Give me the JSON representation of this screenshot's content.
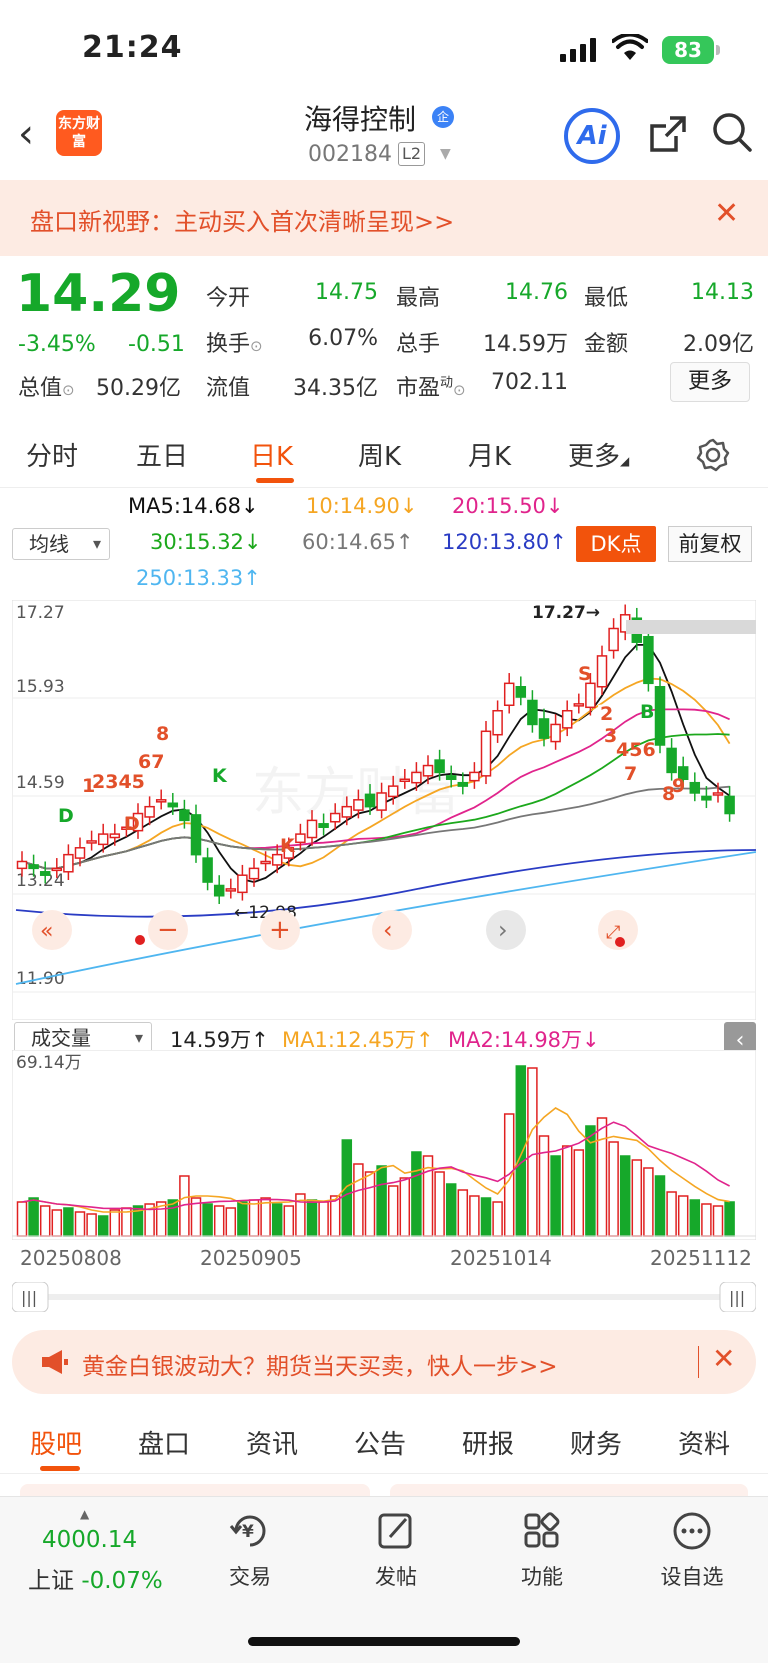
{
  "status_bar": {
    "time": "21:24",
    "battery": "83"
  },
  "header": {
    "back_icon": "chevron-left-icon",
    "logo_text": "东方财富",
    "stock_name": "海得控制",
    "stock_badge": "企",
    "stock_code": "002184",
    "level_badge": "L2",
    "ai_label": "Ai"
  },
  "promo_banner": {
    "text": "盘口新视野：主动买入首次清晰呈现>>",
    "close": "✕"
  },
  "quote": {
    "price": "14.29",
    "change_pct": "-3.45%",
    "change": "-0.51",
    "total_value_label": "总值",
    "total_value": "50.29亿",
    "fields": [
      {
        "label": "今开",
        "value": "14.75"
      },
      {
        "label": "最高",
        "value": "14.76"
      },
      {
        "label": "最低",
        "value": "14.13"
      },
      {
        "label": "换手",
        "value": "6.07%"
      },
      {
        "label": "总手",
        "value": "14.59万"
      },
      {
        "label": "金额",
        "value": "2.09亿"
      },
      {
        "label": "流值",
        "value": "34.35亿"
      },
      {
        "label": "市盈",
        "value": "702.11"
      }
    ],
    "pe_sup": "动",
    "more_button": "更多"
  },
  "period_tabs": {
    "items": [
      "分时",
      "五日",
      "日K",
      "周K",
      "月K",
      "更多"
    ],
    "active": "日K"
  },
  "ma_legend": {
    "selector": "均线",
    "ma5": "MA5:14.68↓",
    "ma10": "10:14.90↓",
    "ma20": "20:15.50↓",
    "ma30": "30:15.32↓",
    "ma60": "60:14.65↑",
    "ma120": "120:13.80↑",
    "ma250": "250:13.33↑",
    "dk_button": "DK点",
    "adjust_button": "前复权",
    "colors": {
      "ma5": "#111111",
      "ma10": "#f5a623",
      "ma20": "#e0248c",
      "ma30": "#1ca81c",
      "ma60": "#777777",
      "ma120": "#2a3cc4",
      "ma250": "#4fb6f0"
    }
  },
  "kline": {
    "y_labels": [
      "17.27",
      "15.93",
      "14.59",
      "13.24",
      "11.90"
    ],
    "high_note": "17.27",
    "low_note": "12.98",
    "watermark": "东方财富",
    "signals": [
      "1",
      "2345",
      "67",
      "8",
      "9",
      "K",
      "D",
      "D",
      "K",
      "B",
      "S",
      "1",
      "2",
      "3",
      "456",
      "7",
      "8",
      "9"
    ]
  },
  "volume": {
    "selector": "成交量",
    "current": "14.59万↑",
    "ma1": "MA1:12.45万↑",
    "ma2": "MA2:14.98万↓",
    "max_label": "69.14万"
  },
  "dates": [
    "20250808",
    "20250905",
    "20251014",
    "20251112"
  ],
  "ad_banner": {
    "text": "黄金白银波动大？期货当天买卖，快人一步>>",
    "close": "✕"
  },
  "sub_tabs": {
    "items": [
      "股吧",
      "盘口",
      "资讯",
      "公告",
      "研报",
      "财务",
      "资料"
    ],
    "active": "股吧"
  },
  "bottom_bar": {
    "index_value": "4000.14",
    "index_name": "上证",
    "index_change": "-0.07%",
    "items": [
      {
        "label": "交易",
        "icon": "yen-exchange-icon"
      },
      {
        "label": "发帖",
        "icon": "edit-post-icon"
      },
      {
        "label": "功能",
        "icon": "grid-apps-icon"
      },
      {
        "label": "设自选",
        "icon": "more-dots-icon"
      }
    ]
  }
}
